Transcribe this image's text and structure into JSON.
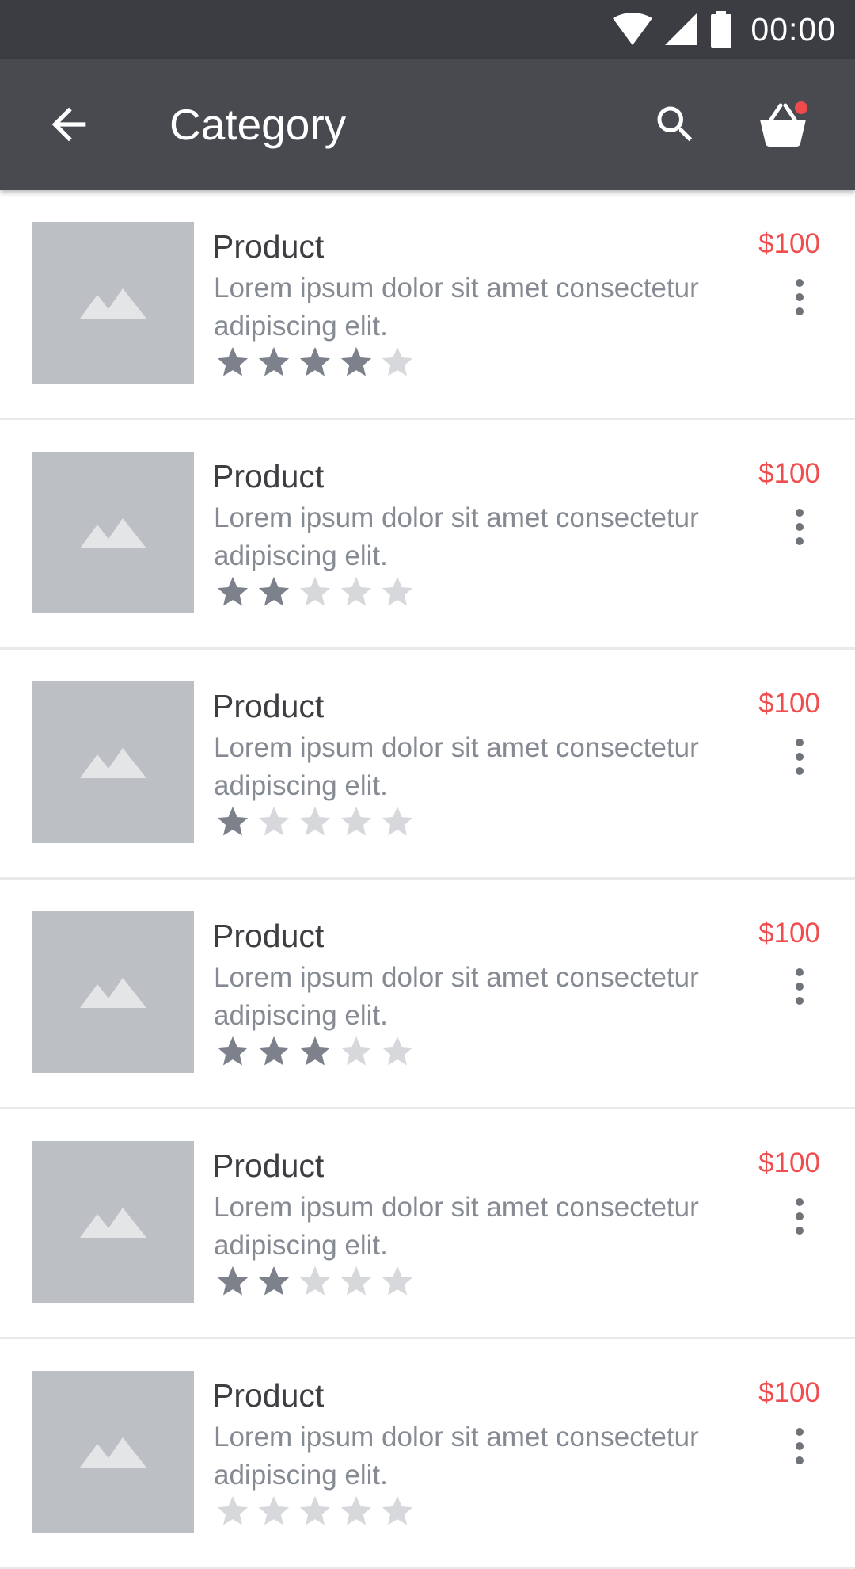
{
  "status_bar": {
    "time": "00:00"
  },
  "app_bar": {
    "title": "Category",
    "cart_has_notification": true
  },
  "colors": {
    "accent": "#f04e4e",
    "star_filled": "#7c818b",
    "star_empty": "#d6d8dc",
    "app_bar": "#484a50",
    "status_bar": "#3b3d42"
  },
  "products": [
    {
      "name": "Product",
      "description": "Lorem ipsum dolor sit amet consectetur adipiscing elit.",
      "price": "$100",
      "rating": 4,
      "max_rating": 5
    },
    {
      "name": "Product",
      "description": "Lorem ipsum dolor sit amet consectetur adipiscing elit.",
      "price": "$100",
      "rating": 2,
      "max_rating": 5
    },
    {
      "name": "Product",
      "description": "Lorem ipsum dolor sit amet consectetur adipiscing elit.",
      "price": "$100",
      "rating": 1,
      "max_rating": 5
    },
    {
      "name": "Product",
      "description": "Lorem ipsum dolor sit amet consectetur adipiscing elit.",
      "price": "$100",
      "rating": 3,
      "max_rating": 5
    },
    {
      "name": "Product",
      "description": "Lorem ipsum dolor sit amet consectetur adipiscing elit.",
      "price": "$100",
      "rating": 2,
      "max_rating": 5
    },
    {
      "name": "Product",
      "description": "Lorem ipsum dolor sit amet consectetur adipiscing elit.",
      "price": "$100",
      "rating": 0,
      "max_rating": 5
    }
  ]
}
